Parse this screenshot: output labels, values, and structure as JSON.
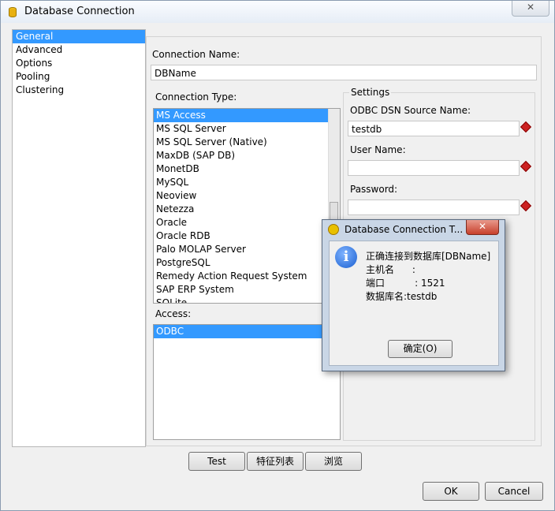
{
  "window": {
    "title": "Database Connection",
    "close": "✕"
  },
  "nav": {
    "items": [
      "General",
      "Advanced",
      "Options",
      "Pooling",
      "Clustering"
    ]
  },
  "form": {
    "connection_name_label": "Connection Name:",
    "connection_name_value": "DBName",
    "connection_type_label": "Connection Type:",
    "connection_types": [
      "MS Access",
      "MS SQL Server",
      "MS SQL Server (Native)",
      "MaxDB (SAP DB)",
      "MonetDB",
      "MySQL",
      "Neoview",
      "Netezza",
      "Oracle",
      "Oracle RDB",
      "Palo MOLAP Server",
      "PostgreSQL",
      "Remedy Action Request System",
      "SAP ERP System",
      "SQLite"
    ],
    "access_label": "Access:",
    "access_items": [
      "ODBC"
    ]
  },
  "settings": {
    "title": "Settings",
    "dsn_label": "ODBC DSN Source Name:",
    "dsn_value": "testdb",
    "user_label": "User Name:",
    "user_value": "",
    "password_label": "Password:",
    "password_value": ""
  },
  "buttons": {
    "test": "Test",
    "features": "特征列表",
    "browse": "浏览",
    "ok": "OK",
    "cancel": "Cancel"
  },
  "dialog": {
    "title": "Database Connection T...",
    "close": "✕",
    "lines": [
      "正确连接到数据库[DBName]",
      "主机名      :",
      "端口          : 1521",
      "数据库名:testdb"
    ],
    "ok": "确定(O)"
  },
  "colors": {
    "selection": "#3399ff",
    "required_marker": "#cc2222"
  }
}
